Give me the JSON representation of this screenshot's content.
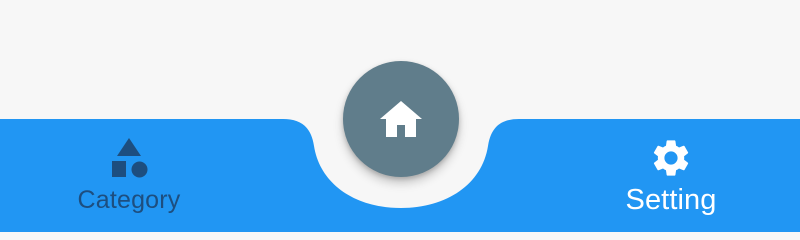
{
  "colors": {
    "background": "#f7f7f7",
    "bottom_bar": "#2196f3",
    "fab": "#607d8b",
    "inactive_nav": "#1d4e7f",
    "active_nav": "#ffffff"
  },
  "bottom_nav": {
    "items": [
      {
        "icon": "category-shapes-icon",
        "label": "Category"
      },
      {
        "icon": "gear-icon",
        "label": "Setting"
      }
    ],
    "fab": {
      "icon": "home-icon"
    }
  }
}
